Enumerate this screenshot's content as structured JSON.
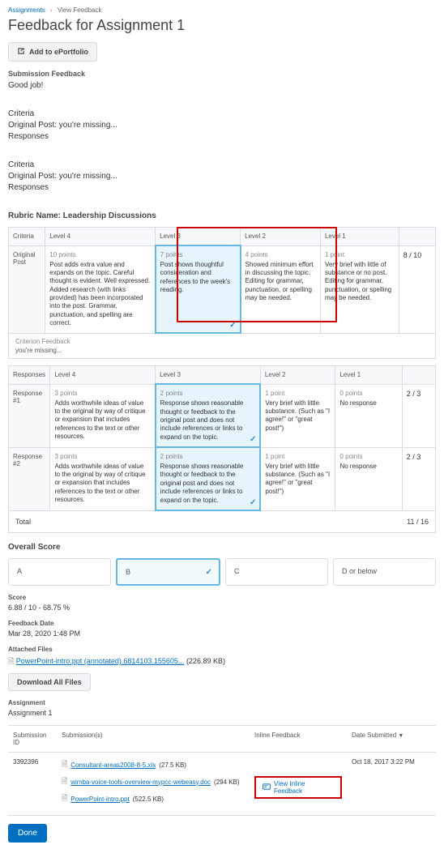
{
  "breadcrumb": {
    "link": "Assignments",
    "current": "View Feedback"
  },
  "title": "Feedback for Assignment 1",
  "eportfolio_btn": "Add to ePortfolio",
  "submission_feedback": {
    "heading": "Submission Feedback",
    "text": "Good job!"
  },
  "criteria_block": {
    "heading": "Criteria",
    "lines": [
      "Original Post: you're missing...",
      "Responses"
    ]
  },
  "rubric": {
    "name_label": "Rubric Name: Leadership Discussions",
    "headers": [
      "Criteria",
      "Level 4",
      "Level 3",
      "Level 2",
      "Level 1",
      ""
    ],
    "row1": {
      "name": "Original Post",
      "l4_pts": "10 points",
      "l4": "Post adds extra value and expands on the topic. Careful thought is evident. Well expressed. Added research (with links provided) has been incorporated into the post. Grammar, punctuation, and spelling are correct.",
      "l3_pts": "7 points",
      "l3": "Post shows thoughtful consideration and references to the week's reading.",
      "l2_pts": "4 points",
      "l2": "Showed minimum effort in discussing the topic. Editing for grammar, punctuation, or spelling may be needed.",
      "l1_pts": "1 point",
      "l1": "Very brief with little of substance or no post. Editing for grammar, punctuation, or spelling may be needed.",
      "score": "8 / 10"
    },
    "cf_label": "Criterion Feedback",
    "cf_text": "you're missing...",
    "headers2": [
      "Responses",
      "Level 4",
      "Level 3",
      "Level 2",
      "Level 1",
      ""
    ],
    "resp": {
      "l4_pts": "3 points",
      "l4": "Adds worthwhile ideas of value to the original by way of critique or expansion that includes references to the text or other resources.",
      "l3_pts": "2 points",
      "l3": "Response shows reasonable thought or feedback to the original post and does not include references or links to expand on the topic.",
      "l2_pts": "1 point",
      "l2": "Very brief with little substance. (Such as \"I agree!\" or \"great post!\")",
      "l1_pts": "0 points",
      "l1": "No response"
    },
    "row2": {
      "name": "Response #1",
      "score": "2 / 3"
    },
    "row3": {
      "name": "Response #2",
      "score": "2 / 3"
    },
    "total_label": "Total",
    "total_val": "11 / 16"
  },
  "overall": {
    "heading": "Overall Score",
    "cards": [
      "A",
      "B",
      "C",
      "D or below"
    ],
    "selected": "B"
  },
  "score": {
    "label": "Score",
    "value": "6.88 / 10 - 68.75 %"
  },
  "feedback_date": {
    "label": "Feedback Date",
    "value": "Mar 28, 2020 1:48 PM"
  },
  "attached": {
    "label": "Attached Files",
    "file_name": "PowerPoint-intro.ppt (annotated).6814103.155605...",
    "file_size": "(226.89 KB)",
    "download_btn": "Download All Files"
  },
  "assignment": {
    "label": "Assignment",
    "value": "Assignment 1"
  },
  "subs": {
    "headers": [
      "Submission ID",
      "Submission(s)",
      "Inline Feedback",
      "Date Submitted"
    ],
    "row": {
      "id": "3392396",
      "files": [
        {
          "name": "Consultant-areas2008-8-5.xls",
          "size": "(27.5 KB)"
        },
        {
          "name": "wimba-voice-tools-overview-mypcc-webeasy.doc",
          "size": "(294 KB)"
        },
        {
          "name": "PowerPoint-intro.ppt",
          "size": "(522.5 KB)"
        }
      ],
      "inline": "View Inline Feedback",
      "date": "Oct 18, 2017 3:22 PM"
    }
  },
  "done_btn": "Done"
}
